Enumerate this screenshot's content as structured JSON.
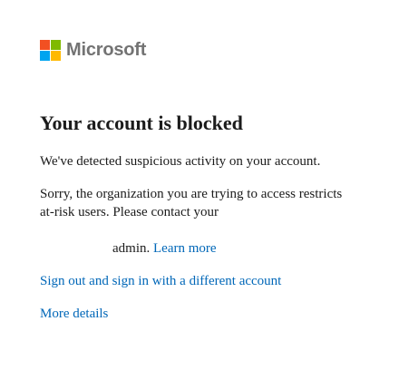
{
  "brand": {
    "name": "Microsoft",
    "logo_colors": [
      "#f25022",
      "#7fba00",
      "#00a4ef",
      "#ffb900"
    ],
    "wordmark_color": "#737373"
  },
  "content": {
    "title": "Your account is blocked",
    "message1": "We've detected suspicious activity on your account.",
    "message2": "Sorry, the organization you are trying to access restricts at-risk users. Please contact your",
    "admin_text": "admin.",
    "learn_more": "Learn more",
    "signout_link": "Sign out and sign in with a different account",
    "more_details": "More details"
  },
  "colors": {
    "link": "#0067b8",
    "text": "#1b1b1b"
  }
}
